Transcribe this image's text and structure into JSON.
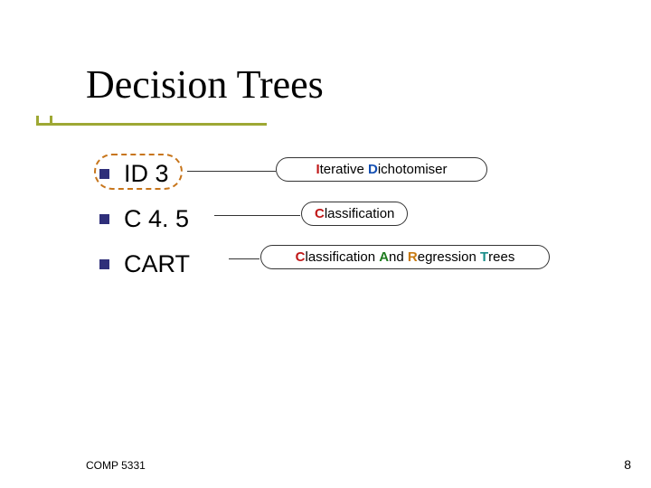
{
  "title": "Decision Trees",
  "bullets": [
    {
      "label": "ID 3"
    },
    {
      "label": "C 4. 5"
    },
    {
      "label": "CART"
    }
  ],
  "callouts": {
    "id3": {
      "lead_letter": "I",
      "lead_rest": "terative ",
      "second_letter": "D",
      "second_rest": "ichotomiser"
    },
    "c45": {
      "lead_letter": "C",
      "lead_rest": "lassification"
    },
    "cart": {
      "c_letter": "C",
      "c_rest": "lassification ",
      "a_letter": "A",
      "a_rest": "nd ",
      "r_letter": "R",
      "r_rest": "egression ",
      "t_letter": "T",
      "t_rest": "rees"
    }
  },
  "footer": {
    "left": "COMP 5331",
    "right": "8"
  }
}
